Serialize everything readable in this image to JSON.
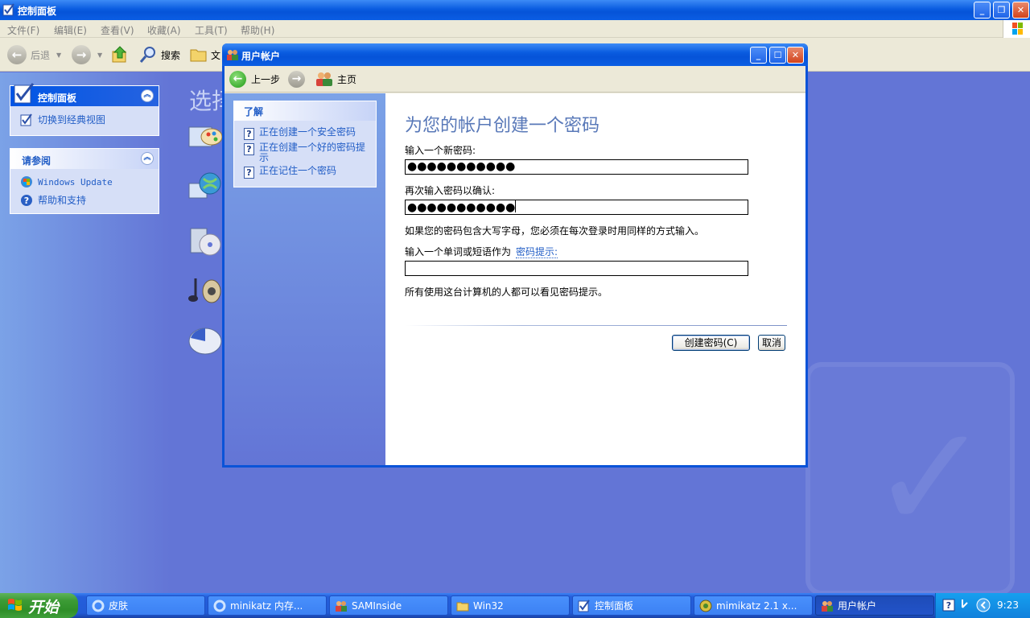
{
  "control_panel": {
    "title": "控制面板",
    "menu": [
      "文件(F)",
      "编辑(E)",
      "查看(V)",
      "收藏(A)",
      "工具(T)",
      "帮助(H)"
    ],
    "toolbar": {
      "back": "后退",
      "search": "搜索",
      "folders": "文"
    },
    "sidebar": {
      "panel_title": "控制面板",
      "switch_view": "切换到经典视图",
      "see_also_title": "请参阅",
      "see_also_items": [
        "Windows Update",
        "帮助和支持"
      ]
    },
    "main_heading": "选择"
  },
  "dialog": {
    "title": "用户帐户",
    "nav": {
      "back": "上一步",
      "home": "主页"
    },
    "learn_title": "了解",
    "learn_items": [
      "正在创建一个安全密码",
      "正在创建一个好的密码提示",
      "正在记住一个密码"
    ],
    "heading": "为您的帐户创建一个密码",
    "new_password_label": "输入一个新密码:",
    "new_password_value": "●●●●●●●●●●●",
    "confirm_label": "再次输入密码以确认:",
    "confirm_value": "●●●●●●●●●●●",
    "case_note": "如果您的密码包含大写字母，您必须在每次登录时用同样的方式输入。",
    "hint_label": "输入一个单词或短语作为",
    "hint_link": "密码提示:",
    "hint_value": "",
    "visibility_note": "所有使用这台计算机的人都可以看见密码提示。",
    "create_button": "创建密码(C)",
    "cancel_button": "取消"
  },
  "taskbar": {
    "start_label": "开始",
    "items": [
      "皮肤",
      "minikatz 内存...",
      "SAMInside",
      "Win32",
      "控制面板",
      "mimikatz 2.1 x...",
      "用户帐户"
    ],
    "active_index": 6,
    "clock": "9:23"
  },
  "colors": {
    "title_blue": "#0a5ce0",
    "panel_blue": "#6375d6",
    "link_blue": "#215dc6",
    "heading_blue": "#5878b8",
    "start_green": "#3c9b35"
  }
}
